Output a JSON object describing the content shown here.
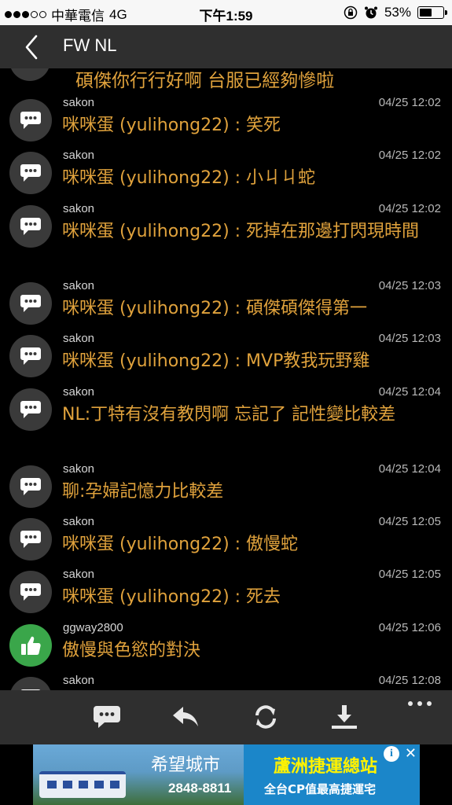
{
  "status_bar": {
    "carrier": "中華電信",
    "network": "4G",
    "time": "下午1:59",
    "battery": "53%",
    "battery_level": 0.53
  },
  "nav": {
    "title": "FW NL"
  },
  "first_message": "碩傑你行行好啊 台服已經夠慘啦",
  "messages": [
    {
      "user": "sakon",
      "time": "04/25 12:02",
      "text": "咪咪蛋 (yulihong22) : 笑死",
      "icon": "speech-bubble-icon"
    },
    {
      "user": "sakon",
      "time": "04/25 12:02",
      "text": "咪咪蛋 (yulihong22) : 小ㄐㄐ蛇",
      "icon": "speech-bubble-icon"
    },
    {
      "user": "sakon",
      "time": "04/25 12:02",
      "text": "咪咪蛋 (yulihong22) : 死掉在那邊打閃現時間",
      "icon": "speech-bubble-icon"
    },
    {
      "user": "sakon",
      "time": "04/25 12:03",
      "text": "咪咪蛋 (yulihong22) : 碩傑碩傑得第一",
      "icon": "speech-bubble-icon"
    },
    {
      "user": "sakon",
      "time": "04/25 12:03",
      "text": "咪咪蛋 (yulihong22) : MVP教我玩野雞",
      "icon": "speech-bubble-icon"
    },
    {
      "user": "sakon",
      "time": "04/25 12:04",
      "text": "NL:丁特有沒有教閃啊 忘記了 記性變比較差",
      "icon": "speech-bubble-icon"
    },
    {
      "user": "sakon",
      "time": "04/25 12:04",
      "text": "聊:孕婦記憶力比較差",
      "icon": "speech-bubble-icon"
    },
    {
      "user": "sakon",
      "time": "04/25 12:05",
      "text": "咪咪蛋 (yulihong22) : 傲慢蛇",
      "icon": "speech-bubble-icon"
    },
    {
      "user": "sakon",
      "time": "04/25 12:05",
      "text": "咪咪蛋 (yulihong22) : 死去",
      "icon": "speech-bubble-icon"
    },
    {
      "user": "ggway2800",
      "time": "04/25 12:06",
      "text": "傲慢與色慾的對決",
      "icon": "thumbs-up-icon"
    },
    {
      "user": "sakon",
      "time": "04/25 12:08",
      "text": "",
      "icon": "speech-bubble-icon"
    }
  ],
  "toolbar": {
    "buttons": [
      "comment-icon",
      "reply-icon",
      "refresh-icon",
      "download-icon",
      "more-icon"
    ]
  },
  "ad": {
    "title": "希望城市",
    "phone": "2848-8811",
    "headline": "蘆洲捷運總站",
    "subline": "全台CP值最高捷運宅",
    "info": "i",
    "close": "✕"
  }
}
